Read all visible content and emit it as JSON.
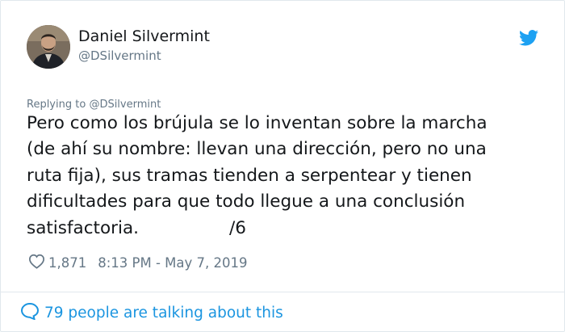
{
  "tweet": {
    "author": {
      "name": "Daniel Silvermint",
      "handle": "@DSilvermint"
    },
    "replying_prefix": "Replying to ",
    "replying_to": "@DSilvermint",
    "body_lines": [
      "Pero como los brújula se lo inventan sobre la marcha",
      "(de ahí su nombre: llevan una dirección, pero no una",
      "ruta fija), sus tramas tienden a serpentear y tienen",
      "dificultades para que todo llegue a una conclusión",
      "satisfactoria."
    ],
    "thread_marker": "/6",
    "likes": "1,871",
    "timestamp": "8:13 PM - May 7, 2019",
    "conversation": "79 people are talking about this",
    "icons": {
      "brand": "twitter-bird-icon",
      "like": "heart-icon",
      "conversation": "speech-bubble-icon"
    },
    "colors": {
      "brand_blue": "#1da1f2",
      "link_blue": "#1b95e0",
      "secondary_text": "#657786",
      "primary_text": "#14171a"
    }
  }
}
